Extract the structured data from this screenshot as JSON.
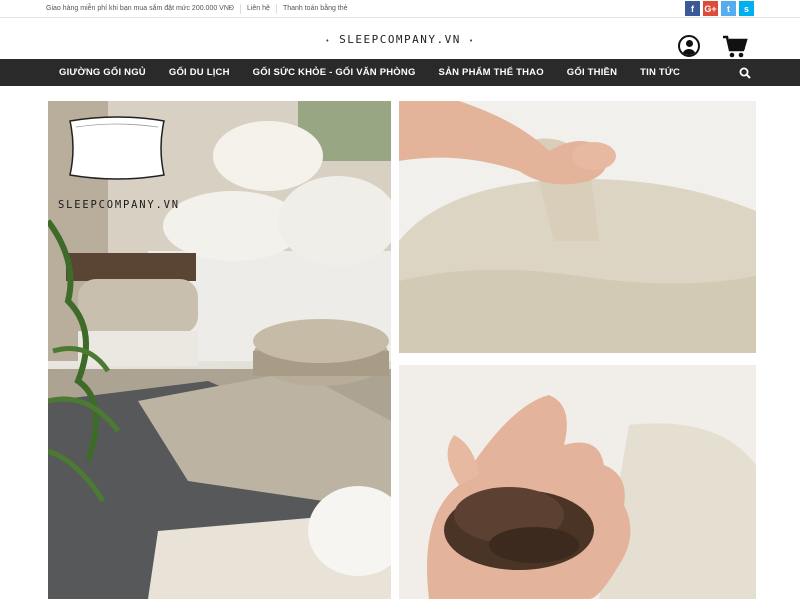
{
  "topbar": {
    "links": [
      "Giao hàng miễn phí khi bạn mua sắm đặt mức 200.000 VNĐ",
      "Liên hệ",
      "Thanh toán bằng thẻ"
    ],
    "social": [
      {
        "name": "facebook",
        "glyph": "f",
        "color": "#3b5998"
      },
      {
        "name": "google-plus",
        "glyph": "G+",
        "color": "#dd4b39"
      },
      {
        "name": "twitter",
        "glyph": "t",
        "color": "#55acee"
      },
      {
        "name": "skype",
        "glyph": "s",
        "color": "#00aff0"
      }
    ]
  },
  "header": {
    "logo": "SLEEPCOMPANY.VN"
  },
  "nav": {
    "items": [
      "GIƯỜNG GỐI NGỦ",
      "GỐI DU LỊCH",
      "GỐI SỨC KHỎE - GỐI VĂN PHÒNG",
      "SẢN PHẨM THỂ THAO",
      "GỐI THIỀN",
      "TIN TỨC"
    ]
  },
  "gallery": {
    "overlay_brand": "SLEEPCOMPANY.VN"
  },
  "colors": {
    "nav_bg": "#2a2a2a",
    "nav_text": "#ffffff",
    "topbar_text": "#555555"
  },
  "icons": {
    "user": "user-icon",
    "cart": "cart-icon",
    "search": "search-icon"
  }
}
